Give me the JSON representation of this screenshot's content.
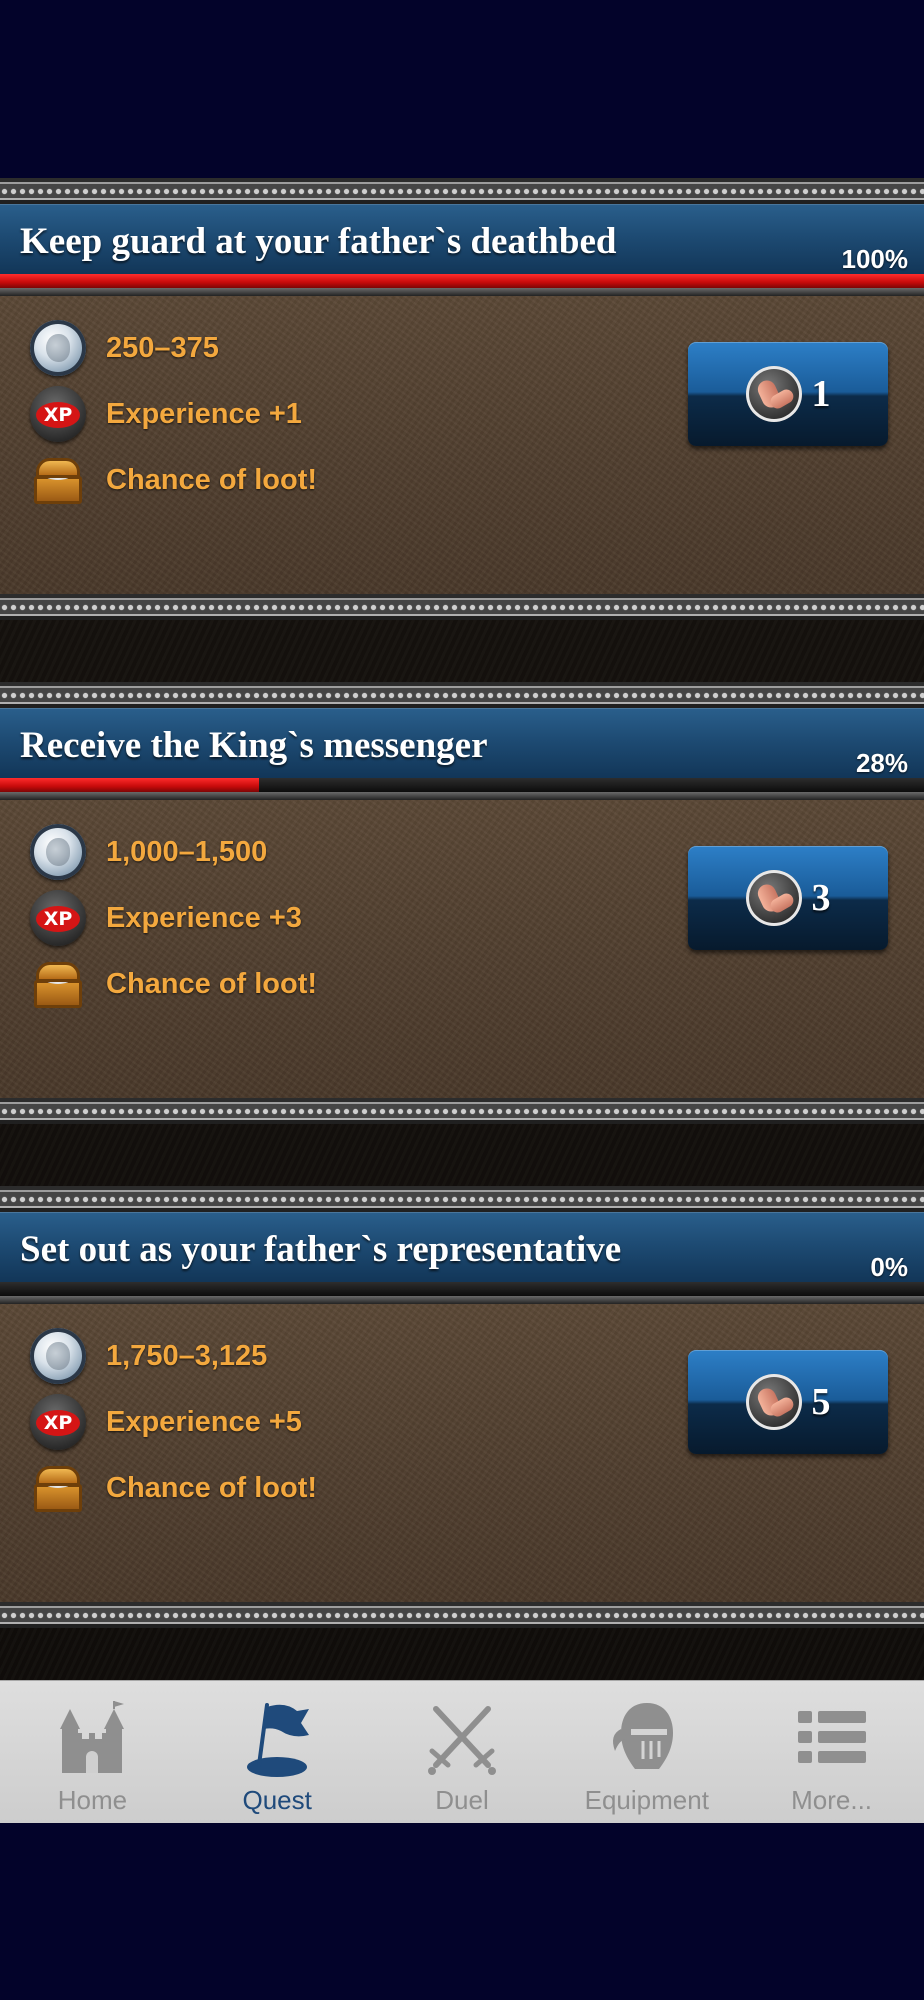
{
  "theme": {
    "accent": "#1f4a7b",
    "reward_text_color": "#f3a83e",
    "progress_color": "#e01414",
    "tab_inactive_color": "#8f8f8f"
  },
  "quests": [
    {
      "title": "Keep guard at your father`s deathbed",
      "percent_label": "100%",
      "progress": 1.0,
      "rewards": {
        "silver": "250–375",
        "experience": "Experience +1",
        "loot": "Chance of loot!"
      },
      "energy_cost": "1"
    },
    {
      "title": "Receive the King`s messenger",
      "percent_label": "28%",
      "progress": 0.28,
      "rewards": {
        "silver": "1,000–1,500",
        "experience": "Experience +3",
        "loot": "Chance of loot!"
      },
      "energy_cost": "3"
    },
    {
      "title": "Set out as your father`s representative",
      "percent_label": "0%",
      "progress": 0.0,
      "rewards": {
        "silver": "1,750–3,125",
        "experience": "Experience +5",
        "loot": "Chance of loot!"
      },
      "energy_cost": "5"
    }
  ],
  "icons": {
    "silver": "silver-coin-icon",
    "experience": "xp-icon",
    "loot": "treasure-chest-icon",
    "energy": "strength-arm-icon"
  },
  "xp_badge_text": "XP",
  "tabs": [
    {
      "label": "Home",
      "icon": "castle-icon",
      "active": false
    },
    {
      "label": "Quest",
      "icon": "quest-flag-icon",
      "active": true
    },
    {
      "label": "Duel",
      "icon": "crossed-swords-icon",
      "active": false
    },
    {
      "label": "Equipment",
      "icon": "knight-helmet-icon",
      "active": false
    },
    {
      "label": "More...",
      "icon": "list-icon",
      "active": false
    }
  ]
}
